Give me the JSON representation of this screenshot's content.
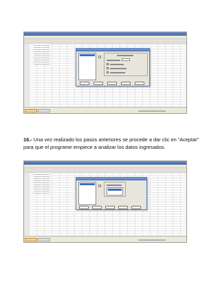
{
  "caption": {
    "number": "16.-",
    "text": " Una vez realizado los pasos anteriores se procede a dar clic en “Aceptar” para que el programe empiece a analizar los datos ingresados."
  },
  "screenshots": [
    {
      "name": "spss-data-editor-with-analysis-dialog-before"
    },
    {
      "name": "spss-data-editor-with-analysis-dialog-after"
    }
  ],
  "colors": {
    "titlebar": "#3c63a7",
    "window_bg": "#ece9d8",
    "selection": "#3a6cc2",
    "page_bg": "#ffffff"
  }
}
